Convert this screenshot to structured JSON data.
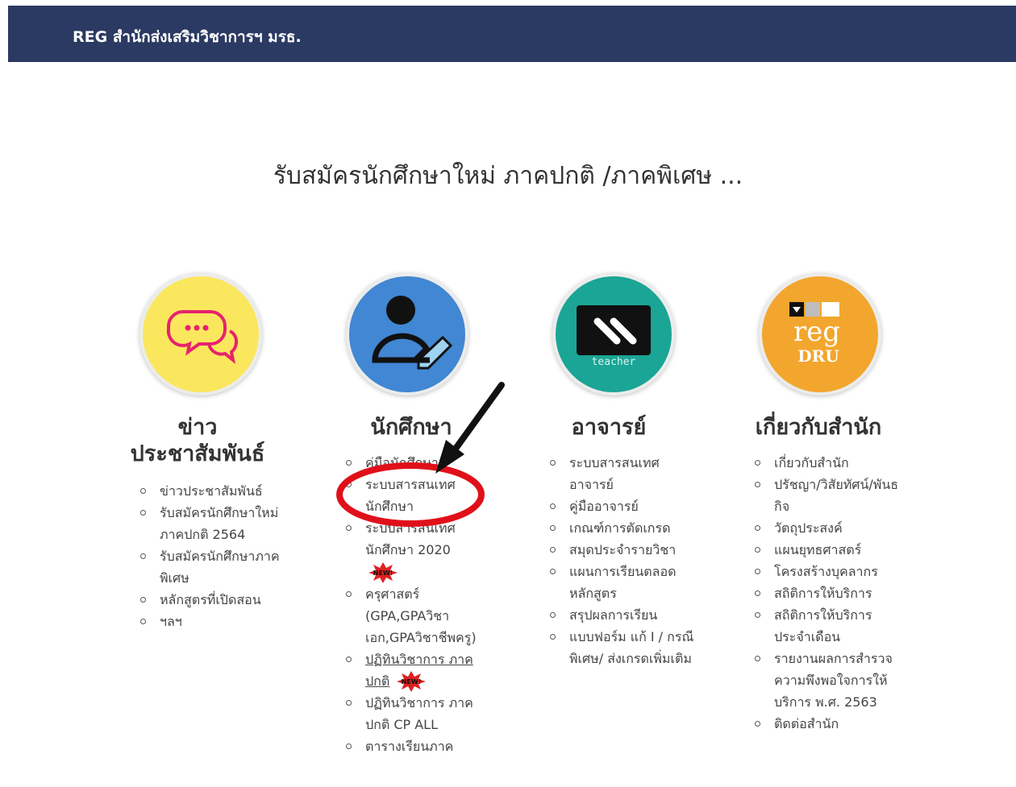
{
  "navbar": {
    "brand": "REG สำนักส่งเสริมวิชาการฯ มรธ."
  },
  "headline": "รับสมัครนักศึกษาใหม่ ภาคปกติ /ภาคพิเศษ ...",
  "columns": {
    "news": {
      "title_line1": "ข่าว",
      "title_line2": "ประชาสัมพันธ์",
      "items": [
        "ข่าวประชาสัมพันธ์",
        "รับสมัครนักศึกษาใหม่ ภาคปกติ 2564",
        "รับสมัครนักศึกษาภาคพิเศษ",
        "หลักสูตรที่เปิดสอน",
        "ฯลฯ"
      ]
    },
    "student": {
      "title": "นักศึกษา",
      "items": [
        "คู่มือนักศึกษา",
        "ระบบสารสนเทศนักศึกษา",
        "ระบบสารสนเทศนักศึกษา 2020",
        "ครุศาสตร์ (GPA,GPAวิชาเอก,GPAวิชาชีพครู)",
        "ปฏิทินวิชาการ ภาคปกติ",
        "ปฏิทินวิชาการ ภาคปกติ CP ALL",
        "ตารางเรียนภาค"
      ],
      "new_badge": "NEW!"
    },
    "teacher": {
      "title": "อาจารย์",
      "icon_caption": "teacher",
      "items": [
        "ระบบสารสนเทศอาจารย์",
        "คู่มืออาจารย์",
        "เกณฑ์การตัดเกรด",
        "สมุดประจำรายวิชา",
        "แผนการเรียนตลอดหลักสูตร",
        "สรุปผลการเรียน",
        "แบบฟอร์ม แก้ I / กรณีพิเศษ/ ส่งเกรดเพิ่มเติม"
      ]
    },
    "about": {
      "title": "เกี่ยวกับสำนัก",
      "logo_line1": "reg",
      "logo_line2": "DRU",
      "items": [
        "เกี่ยวกับสำนัก",
        "ปรัชญา/วิสัยทัศน์/พันธกิจ",
        "วัตถุประสงค์",
        "แผนยุทธศาสตร์",
        "โครงสร้างบุคลากร",
        "สถิติการให้บริการ",
        "สถิติการให้บริการประจำเดือน",
        "รายงานผลการสำรวจความพึงพอใจการให้บริการ พ.ศ. 2563",
        "ติดต่อสำนัก"
      ]
    }
  },
  "colors": {
    "navbar": "#2b3a62",
    "news_circle": "#fbe75d",
    "student_circle": "#4187d3",
    "teacher_circle": "#1aa596",
    "about_circle": "#f3a62d",
    "annotation_red": "#e0101a"
  }
}
